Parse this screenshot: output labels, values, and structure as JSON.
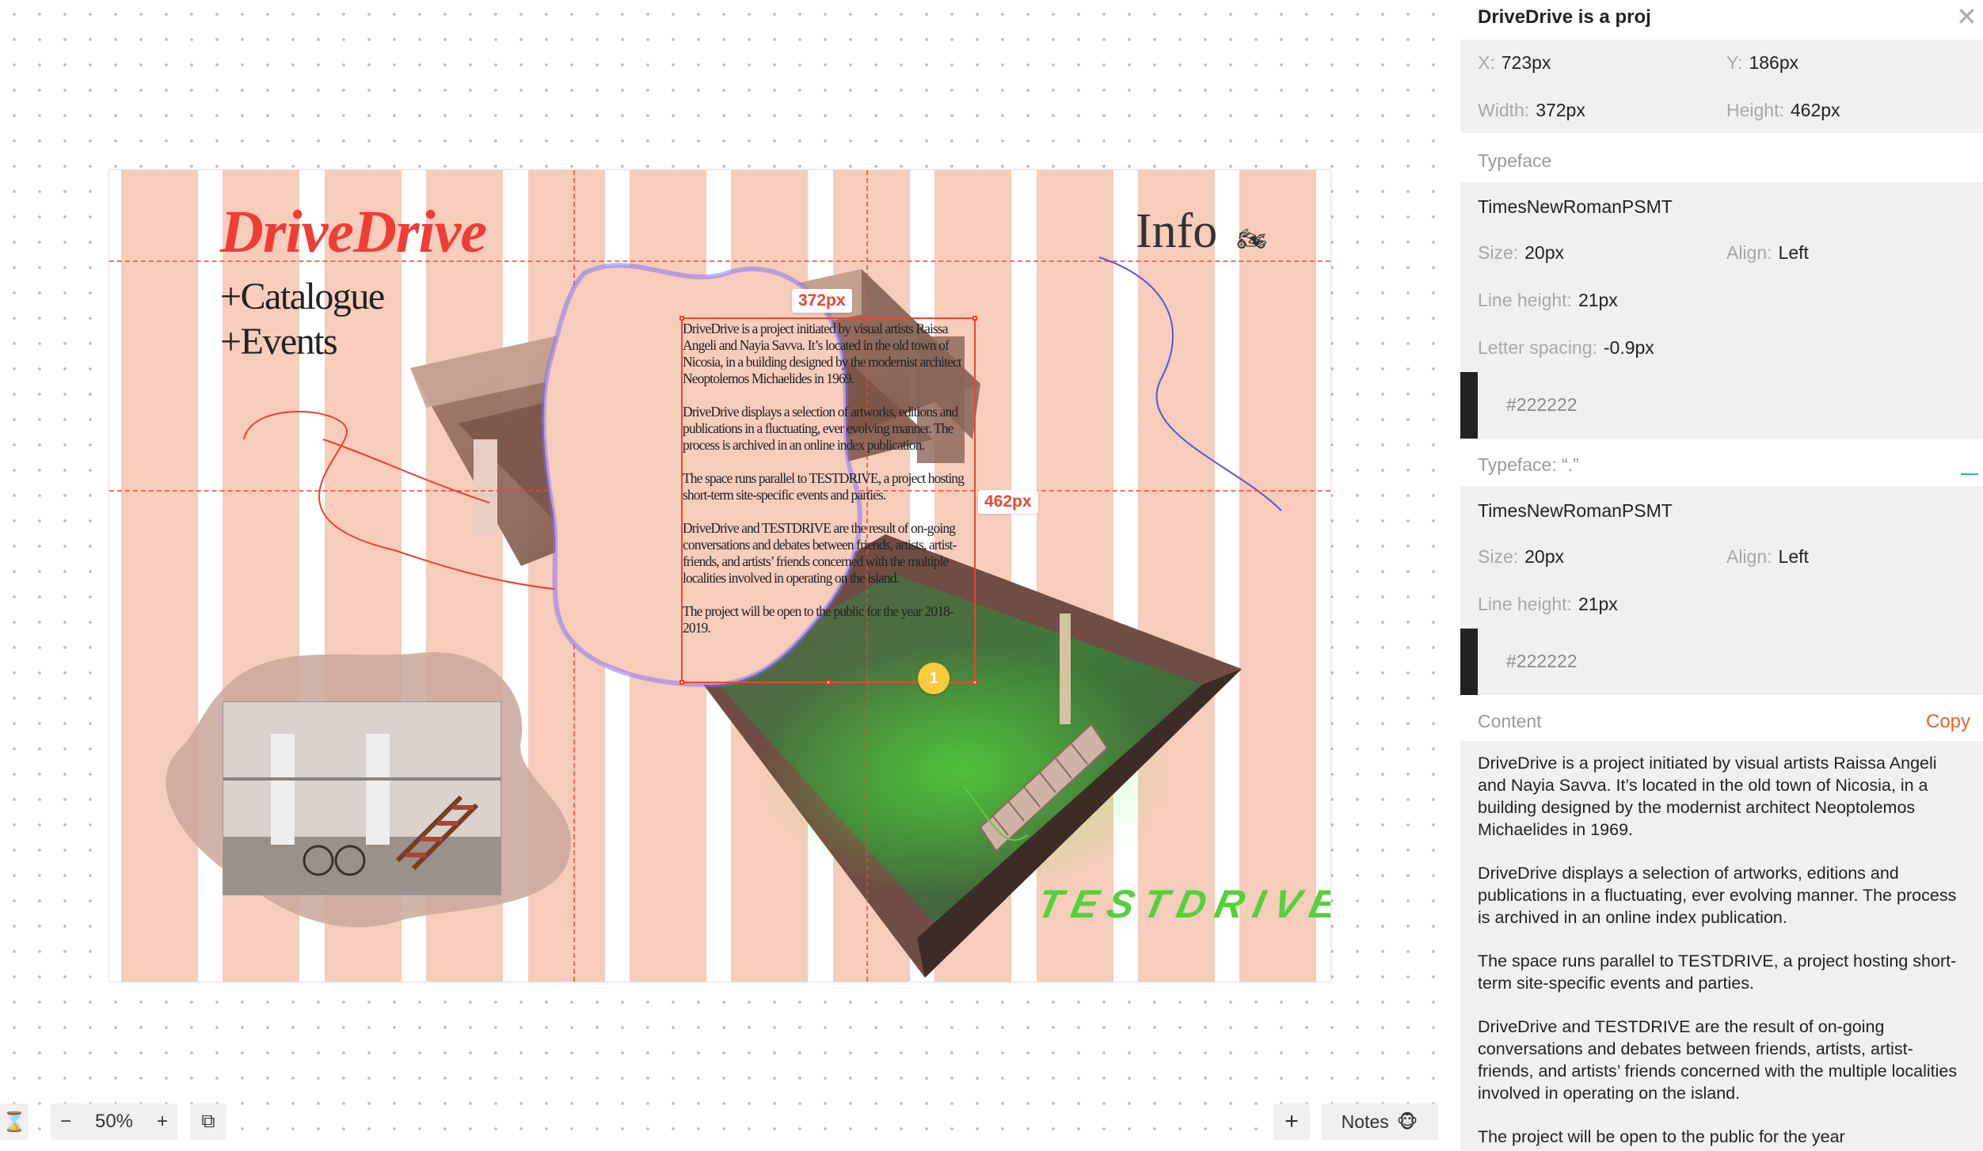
{
  "artboard": {
    "logo": "DriveDrive",
    "nav": [
      "+Catalogue",
      "+Events"
    ],
    "info_link": "Info",
    "moto_icon": "🏍",
    "body_paragraphs": [
      "DriveDrive is a project initiated by visual artists Raissa Angeli and Nayia Savva. It’s located in the old town of Nicosia, in a building designed by the modernist architect Neoptolemos Michaelides in 1969.",
      "DriveDrive displays a selection of artworks, editions and publications in a fluctuating, ever evolving manner. The process is archived in an online index publication.",
      "The space runs parallel to TESTDRIVE, a project hosting short-term site-specific events and parties.",
      "DriveDrive and TESTDRIVE are the result of on-going conversations and debates between friends, artists, artist-friends, and artists’ friends concerned with the multiple localities involved in operating on the island.",
      "The project will be open to the public for the year 2018-2019."
    ],
    "testdrive": "TESTDRIVE",
    "width_badge": "372px",
    "height_badge": "462px",
    "note_pin": "1",
    "colors": {
      "stripe": "#f6ccba",
      "logo": "#ef3d35",
      "guide": "#eb4632",
      "testdrive": "#53d23a"
    }
  },
  "toolbar": {
    "timer_icon": "⌛",
    "zoom_out": "−",
    "zoom_level": "50%",
    "zoom_in": "+",
    "open_icon": "⧉",
    "add": "+",
    "notes_label": "Notes",
    "notes_emoji": "🐵"
  },
  "inspector": {
    "title": "DriveDrive is a proj",
    "close": "✕",
    "x_label": "X:",
    "x_value": "723px",
    "y_label": "Y:",
    "y_value": "186px",
    "width_label": "Width:",
    "width_value": "372px",
    "height_label": "Height:",
    "height_value": "462px",
    "typeface_heading": "Typeface",
    "font_name": "TimesNewRomanPSMT",
    "size_label": "Size:",
    "size_value": "20px",
    "align_label": "Align:",
    "align_value": "Left",
    "line_height_label": "Line height:",
    "line_height_value": "21px",
    "letter_spacing_label": "Letter spacing:",
    "letter_spacing_value": "-0.9px",
    "color_hex": "#222222",
    "typeface2_heading": "Typeface: “.”",
    "font2_name": "TimesNewRomanPSMT",
    "size2_value": "20px",
    "align2_value": "Left",
    "line_height2_value": "21px",
    "color2_hex": "#222222",
    "content_heading": "Content",
    "copy_label": "Copy",
    "content_paragraphs": [
      "DriveDrive is a project initiated by visual artists Raissa Angeli and Nayia Savva. It’s located in the old town of Nicosia, in a building designed by the modernist architect Neoptolemos Michaelides in 1969.",
      "DriveDrive displays a selection of artworks, editions and publications in a fluctuating,       ever evolving manner. The process is archived    in an online index publication.",
      "The space runs parallel to TESTDRIVE, a project hosting short-term site-specific events and parties.",
      "DriveDrive and TESTDRIVE are the result of on-going conversations and debates between             friends, artists, artist-friends, and artists’ friends concerned with the multiple localities involved in operating on the island.",
      "The project will be open to the public for the year"
    ]
  }
}
